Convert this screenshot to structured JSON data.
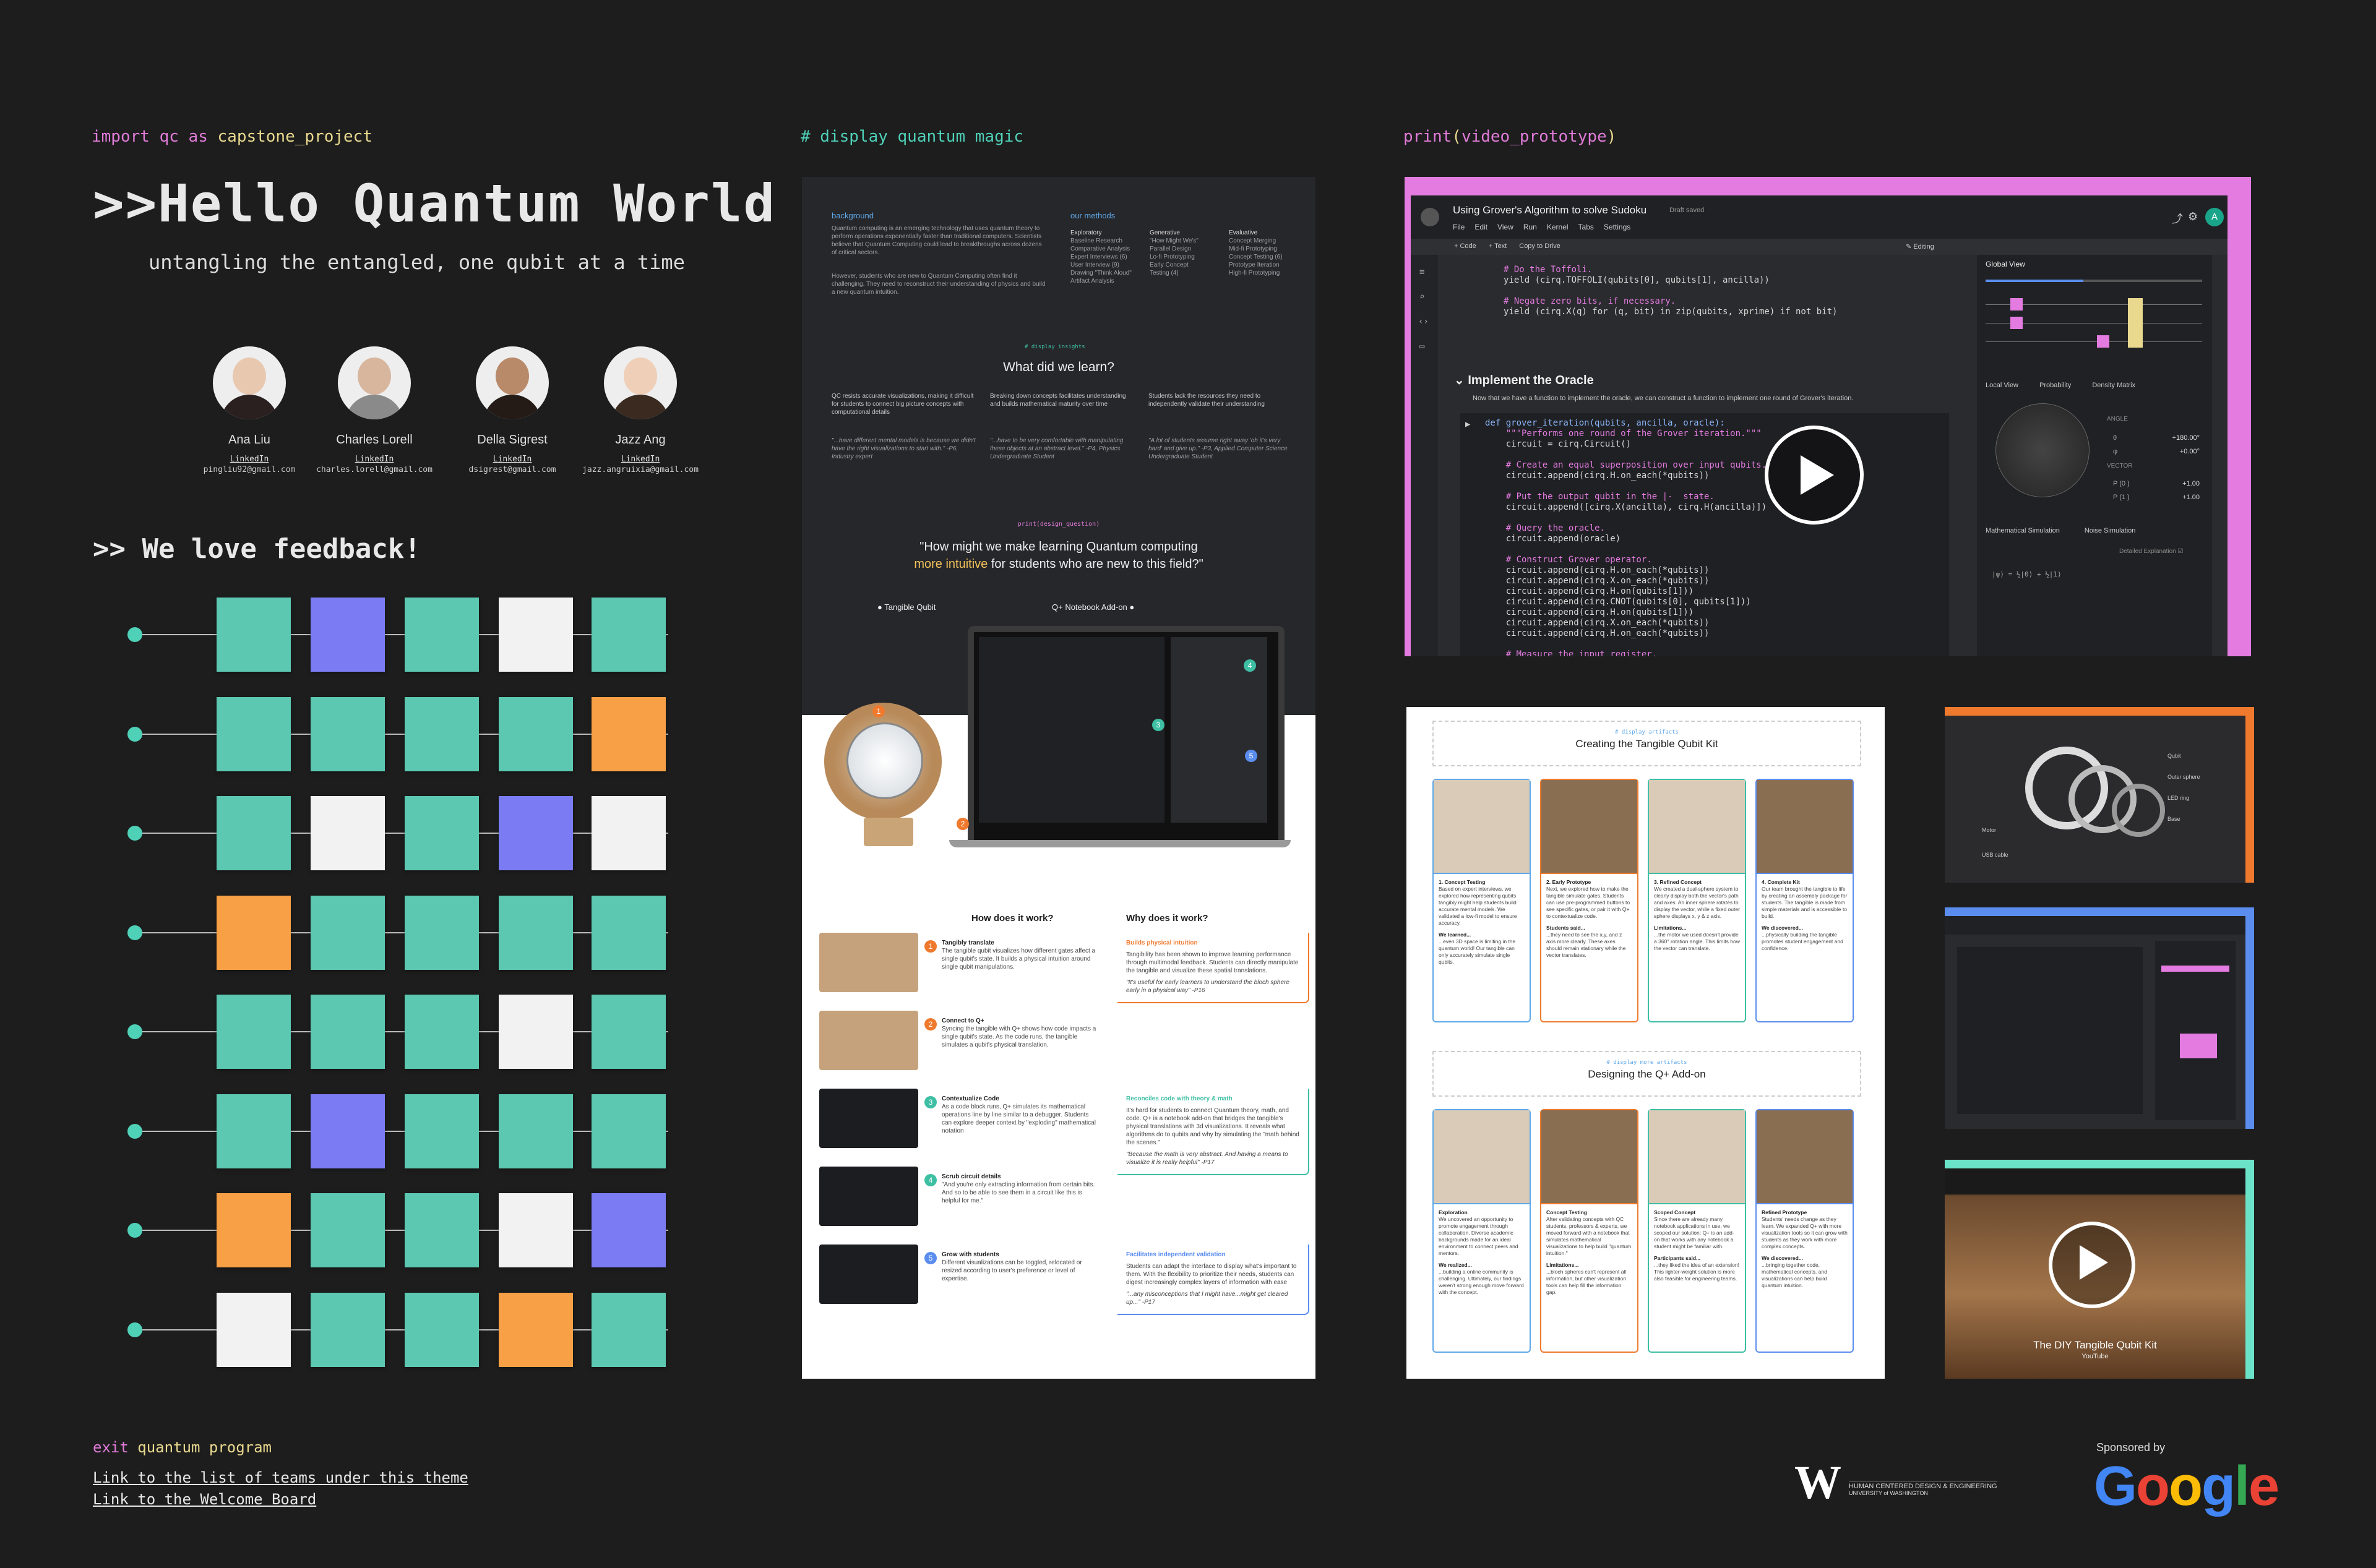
{
  "left": {
    "import_kw": "import",
    "import_mod": "qc",
    "as_kw": "as",
    "import_alias": "capstone_project",
    "title": ">>Hello Quantum World",
    "subtitle": "untangling the entangled, one qubit at a time",
    "members": [
      {
        "name": "Ana Liu",
        "link": "LinkedIn",
        "email": "pingliu92@gmail.com"
      },
      {
        "name": "Charles Lorell",
        "link": "LinkedIn",
        "email": "charles.lorell@gmail.com"
      },
      {
        "name": "Della Sigrest",
        "link": "LinkedIn",
        "email": "dsigrest@gmail.com"
      },
      {
        "name": "Jazz Ang",
        "link": "LinkedIn",
        "email": "jazz.angruixia@gmail.com"
      }
    ],
    "feedback_title": ">> We love feedback!",
    "feedback_rows": [
      [
        "#5cc8b2",
        "#7b7cf4",
        "#5cc8b2",
        "#f2f2f2",
        "#5cc8b2"
      ],
      [
        "#5cc8b2",
        "#5cc8b2",
        "#5cc8b2",
        "#5cc8b2",
        "#f8a046"
      ],
      [
        "#5cc8b2",
        "#f2f2f2",
        "#5cc8b2",
        "#7b7cf4",
        "#f2f2f2"
      ],
      [
        "#f8a046",
        "#5cc8b2",
        "#5cc8b2",
        "#5cc8b2",
        "#5cc8b2"
      ],
      [
        "#5cc8b2",
        "#5cc8b2",
        "#5cc8b2",
        "#f2f2f2",
        "#5cc8b2"
      ],
      [
        "#5cc8b2",
        "#7b7cf4",
        "#5cc8b2",
        "#5cc8b2",
        "#5cc8b2"
      ],
      [
        "#f8a046",
        "#5cc8b2",
        "#5cc8b2",
        "#f2f2f2",
        "#7b7cf4"
      ],
      [
        "#f2f2f2",
        "#5cc8b2",
        "#5cc8b2",
        "#f8a046",
        "#5cc8b2"
      ]
    ],
    "exit_kw": "exit",
    "exit_text": "quantum program",
    "link_teams": "Link to the list of teams under this theme",
    "link_welcome": "Link to the Welcome Board"
  },
  "middle": {
    "header": "# display quantum magic",
    "poster": {
      "background_title": "background",
      "background_text": "Quantum computing is an emerging technology that uses quantum theory to perform operations exponentially faster than traditional computers. Scientists believe that Quantum Computing could lead to breakthroughs across dozens of critical sectors.",
      "background_text2": "However, students who are new to Quantum Computing often find it challenging. They need to reconstruct their understanding of physics and build a new quantum intuition.",
      "methods_title": "our methods",
      "methods_cols": [
        {
          "head": "Exploratory",
          "items": [
            "Baseline Research",
            "Comparative Analysis",
            "Expert Interviews (6)",
            "User Interview (9)",
            "Drawing \"Think Aloud\"",
            "Artifact Analysis"
          ]
        },
        {
          "head": "Generative",
          "items": [
            "\"How Might We's\"",
            "Parallel Design",
            "Lo-fi Prototyping",
            "Early Concept",
            "Testing (4)"
          ]
        },
        {
          "head": "Evaluative",
          "items": [
            "Concept Merging",
            "Mid-fi Prototyping",
            "Concept Testing (6)",
            "Prototype Iteration",
            "High-fi Prototyping"
          ]
        }
      ],
      "insights_tag": "# display insights",
      "insights_title": "What did we learn?",
      "insights": [
        "QC resists accurate visualizations, making it difficult for students to connect big picture concepts with computational details",
        "Breaking down concepts facilitates understanding and builds mathematical maturity over time",
        "Students lack the resources they need to independently validate their understanding"
      ],
      "quotes": [
        "\"...have different mental models is because we didn't have the right visualizations to start with.\" -P6, Industry expert",
        "\"...have to be very comfortable with manipulating these objects at an abstract level.\" -P4, Physics Undergraduate Student",
        "\"A lot of students assume right away 'oh it's very hard' and give up.\" -P3, Applied Computer Science Undergraduate Student"
      ],
      "design_tag": "print(design_question)",
      "question_line1": "\"How might we make learning Quantum computing",
      "question_highlight": "more intuitive",
      "question_line2": "for students who are new to this field?\"",
      "label_qubit": "Tangible Qubit",
      "label_addon": "Q+ Notebook Add-on",
      "how_title": "How does it work?",
      "why_title": "Why does it work?",
      "steps": [
        {
          "n": "1",
          "color": "#ef7a2e",
          "title": "Tangibly translate",
          "text": "The tangible qubit visualizes how different gates affect a single qubit's state. It builds a physical intuition around single qubit manipulations.",
          "why_title": "Builds physical intuition",
          "why_text": "Tangibility has been shown to improve learning performance through multimodal feedback. Students can directly manipulate the tangible and visualize these spatial translations.",
          "why_quote": "\"It's useful for early learners to understand the bloch sphere early in a physical way\" -P16"
        },
        {
          "n": "2",
          "color": "#ef7a2e",
          "title": "Connect to Q+",
          "text": "Syncing the tangible with Q+ shows how code impacts a single qubit's state. As the code runs, the tangible simulates a qubit's physical translation.",
          "why_title": "",
          "why_text": "",
          "why_quote": ""
        },
        {
          "n": "3",
          "color": "#3ebfa4",
          "title": "Contextualize Code",
          "text": "As a code block runs, Q+ simulates its mathematical operations line by line similar to a debugger. Students can explore deeper context by \"exploding\" mathematical notation",
          "why_title": "Reconciles code with theory & math",
          "why_text": "It's hard for students to connect Quantum theory, math, and code. Q+ is a notebook add-on that bridges the tangible's physical translations with 3d visualizations. It reveals what algorithms do to qubits and why by simulating the \"math behind the scenes.\"",
          "why_quote": "\"Because the math is very abstract. And having a means to visualize it is really helpful\" -P17"
        },
        {
          "n": "4",
          "color": "#3ebfa4",
          "title": "Scrub circuit details",
          "text": "\"And you're only extracting information from certain bits. And so to be able to see them in a circuit like this is helpful for me.\"",
          "why_title": "",
          "why_text": "",
          "why_quote": ""
        },
        {
          "n": "5",
          "color": "#5b8def",
          "title": "Grow with students",
          "text": "Different visualizations can be toggled, relocated or resized according to user's preference or level of expertise.",
          "why_title": "Facilitates independent validation",
          "why_text": "Students can adapt the interface to display what's important to them. With the flexibility to prioritize their needs, students can digest increasingly complex layers of information with ease",
          "why_quote": "\"...any misconceptions that I might have...might get cleared up...\" -P17"
        }
      ]
    }
  },
  "right": {
    "header_fn": "print",
    "header_arg": "video_prototype",
    "notebook": {
      "title": "Using Grover's Algorithm to solve Sudoku",
      "saved": "Draft saved",
      "menu": [
        "File",
        "Edit",
        "View",
        "Run",
        "Kernel",
        "Tabs",
        "Settings"
      ],
      "toolbar": [
        "+ Code",
        "+ Text",
        "Copy to Drive"
      ],
      "editing": "Editing",
      "section": "Implement the Oracle",
      "section_text": "Now that we have a function to implement the oracle, we can construct a function to implement one round of Grover's iteration.",
      "code_top": [
        "# Do the Toffoli.",
        "yield (cirq.TOFFOLI(qubits[0], qubits[1], ancilla))",
        "",
        "# Negate zero bits, if necessary.",
        "yield (cirq.X(q) for (q, bit) in zip(qubits, xprime) if not bit)"
      ],
      "code_main": [
        "def grover_iteration(qubits, ancilla, oracle):",
        "    \"\"\"Performs one round of the Grover iteration.\"\"\"",
        "    circuit = cirq.Circuit()",
        "",
        "    # Create an equal superposition over input qubits.",
        "    circuit.append(cirq.H.on_each(*qubits))",
        "",
        "    # Put the output qubit in the |-  state.",
        "    circuit.append([cirq.X(ancilla), cirq.H(ancilla)])",
        "",
        "    # Query the oracle.",
        "    circuit.append(oracle)",
        "",
        "    # Construct Grover operator.",
        "    circuit.append(cirq.H.on_each(*qubits))",
        "    circuit.append(cirq.X.on_each(*qubits))",
        "    circuit.append(cirq.H.on(qubits[1]))",
        "    circuit.append(cirq.CNOT(qubits[0], qubits[1]))",
        "    circuit.append(cirq.H.on(qubits[1]))",
        "    circuit.append(cirq.X.on_each(*qubits))",
        "    circuit.append(cirq.H.on_each(*qubits))",
        "",
        "    # Measure the input register."
      ],
      "panel_global": "Global View",
      "panel_tabs": [
        "Local View",
        "Probability",
        "Density Matrix"
      ],
      "panel_params": [
        {
          "k": "θ",
          "v": "+180.00°"
        },
        {
          "k": "φ",
          "v": "+0.00°"
        },
        {
          "k": "P (0 )",
          "v": "+1.00"
        },
        {
          "k": "P (1 )",
          "v": "+1.00"
        }
      ],
      "panel_angle": "ANGLE",
      "panel_vector": "VECTOR",
      "panel_bottom_tabs": [
        "Mathematical Simulation",
        "Noise Simulation"
      ],
      "panel_detailed": "Detailed Explanation",
      "avatar_letter": "A"
    },
    "artifacts": {
      "tag1": "# display artifacts",
      "title1": "Creating the Tangible Qubit Kit",
      "cards1": [
        {
          "color": "#5fa8e8",
          "title": "1. Concept Testing",
          "text": "Based on expert interviews, we explored how representing qubits tangibly might help students build accurate mental models. We validated a low-fi model to ensure accuracy.",
          "learn": "We learned...",
          "learn_text": "...even 3D space is limiting in the quantum world! Our tangible can only accurately simulate single qubits."
        },
        {
          "color": "#ef7a2e",
          "title": "2. Early Prototype",
          "text": "Next, we explored how to make the tangible simulate gates. Students can use pre-programmed buttons to see specific gates, or pair it with Q+ to contextualize code.",
          "learn": "Students said...",
          "learn_text": "...they need to see the x,y, and z axis more clearly. These axes should remain stationary while the vector translates."
        },
        {
          "color": "#3ebfa4",
          "title": "3. Refined Concept",
          "text": "We created a dual-sphere system to clearly display both the vector's path and axes. An inner sphere rotates to display the vector, while a fixed outer sphere displays x, y & z axis.",
          "learn": "Limitations...",
          "learn_text": "...the motor we used doesn't provide a 360° rotation angle. This limits how the vector can translate."
        },
        {
          "color": "#5b8def",
          "title": "4. Complete Kit",
          "text": "Our team brought the tangible to life by creating an assembly package for students. The tangible is made from simple materials and is accessible to build.",
          "learn": "We discovered...",
          "learn_text": "...physically building the tangible promotes student engagement and confidence."
        }
      ],
      "tag2": "# display more artifacts",
      "title2": "Designing the Q+ Add-on",
      "cards2": [
        {
          "color": "#5fa8e8",
          "title": "Exploration",
          "text": "We uncovered an opportunity to promote engagement through collaboration. Diverse academic backgrounds made for an ideal environment to connect peers and mentors.",
          "learn": "We realized...",
          "learn_text": "...building a online community is challenging. Ultimately, our findings weren't strong enough move forward with the concept."
        },
        {
          "color": "#ef7a2e",
          "title": "Concept Testing",
          "text": "After validating concepts with QC students, professors & experts, we moved forward with a notebook that simulates mathematical visualizations to help build \"quantum intuition.\"",
          "learn": "Limitations...",
          "learn_text": "...bloch spheres can't represent all information, but other visualization tools can help fill the information gap."
        },
        {
          "color": "#3ebfa4",
          "title": "Scoped Concept",
          "text": "Since there are already many notebook applications in use, we scoped our solution: Q+ is an add-on that works with any notebook a student might be familiar with.",
          "learn": "Participants said...",
          "learn_text": "...they liked the idea of an extension! This lighter-weight solution is more also feasible for engineering teams."
        },
        {
          "color": "#5b8def",
          "title": "Refined Prototype",
          "text": "Students' needs change as they learn. We expanded Q+ with more visualization tools so it can grow with students as they work with more complex concepts.",
          "learn": "We discovered...",
          "learn_text": "...bringing together code, mathematical concepts, and visualizations can help build quantum intuition."
        }
      ]
    },
    "exploded_labels": [
      "Qubit",
      "Outer sphere",
      "LED ring",
      "Base",
      "Motor",
      "USB cable"
    ],
    "yt_title": "The DIY Tangible Qubit Kit",
    "yt_sub": "YouTube",
    "sponsor": "Sponsored by",
    "google": "Google",
    "uw_line1": "HUMAN CENTERED DESIGN & ENGINEERING",
    "uw_line2": "UNIVERSITY of WASHINGTON"
  }
}
